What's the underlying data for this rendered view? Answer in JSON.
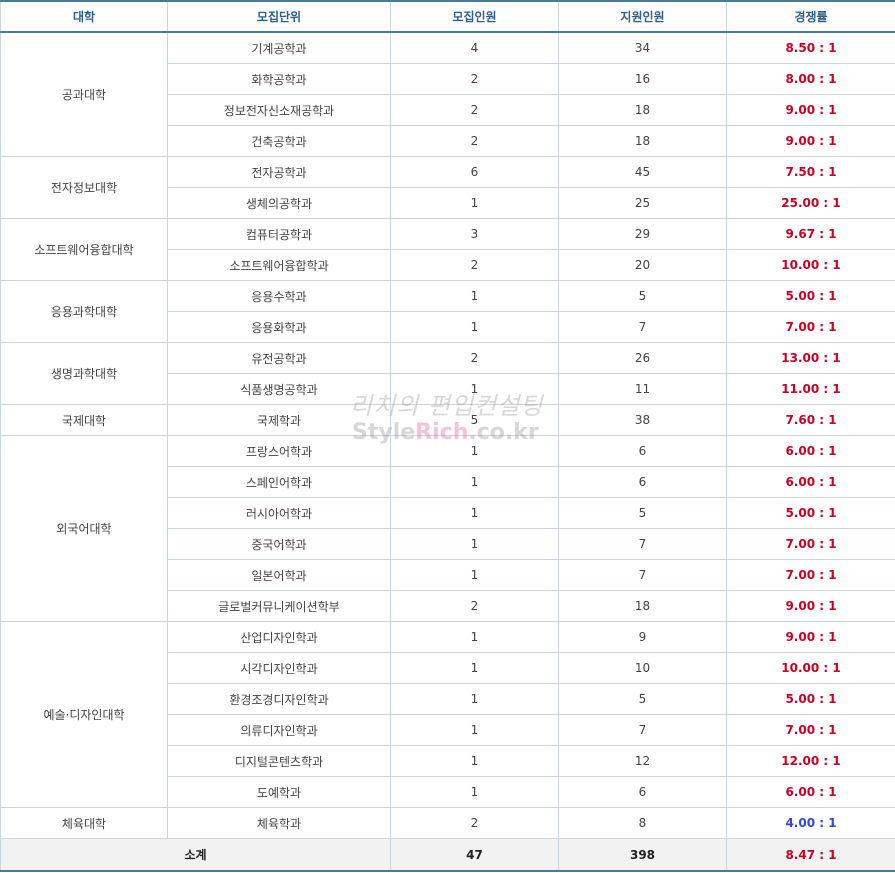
{
  "headers": {
    "college": "대학",
    "unit": "모집단위",
    "quota": "모집인원",
    "applicants": "지원인원",
    "ratio": "경쟁률"
  },
  "groups": [
    {
      "college": "공과대학",
      "rows": [
        {
          "unit": "기계공학과",
          "quota": "4",
          "applicants": "34",
          "ratio": "8.50 : 1"
        },
        {
          "unit": "화학공학과",
          "quota": "2",
          "applicants": "16",
          "ratio": "8.00 : 1"
        },
        {
          "unit": "정보전자신소재공학과",
          "quota": "2",
          "applicants": "18",
          "ratio": "9.00 : 1"
        },
        {
          "unit": "건축공학과",
          "quota": "2",
          "applicants": "18",
          "ratio": "9.00 : 1"
        }
      ]
    },
    {
      "college": "전자정보대학",
      "rows": [
        {
          "unit": "전자공학과",
          "quota": "6",
          "applicants": "45",
          "ratio": "7.50 : 1"
        },
        {
          "unit": "생체의공학과",
          "quota": "1",
          "applicants": "25",
          "ratio": "25.00 : 1"
        }
      ]
    },
    {
      "college": "소프트웨어융합대학",
      "rows": [
        {
          "unit": "컴퓨터공학과",
          "quota": "3",
          "applicants": "29",
          "ratio": "9.67 : 1"
        },
        {
          "unit": "소프트웨어융합학과",
          "quota": "2",
          "applicants": "20",
          "ratio": "10.00 : 1"
        }
      ]
    },
    {
      "college": "응용과학대학",
      "rows": [
        {
          "unit": "응용수학과",
          "quota": "1",
          "applicants": "5",
          "ratio": "5.00 : 1"
        },
        {
          "unit": "응용화학과",
          "quota": "1",
          "applicants": "7",
          "ratio": "7.00 : 1"
        }
      ]
    },
    {
      "college": "생명과학대학",
      "rows": [
        {
          "unit": "유전공학과",
          "quota": "2",
          "applicants": "26",
          "ratio": "13.00 : 1"
        },
        {
          "unit": "식품생명공학과",
          "quota": "1",
          "applicants": "11",
          "ratio": "11.00 : 1"
        }
      ]
    },
    {
      "college": "국제대학",
      "rows": [
        {
          "unit": "국제학과",
          "quota": "5",
          "applicants": "38",
          "ratio": "7.60 : 1"
        }
      ]
    },
    {
      "college": "외국어대학",
      "rows": [
        {
          "unit": "프랑스어학과",
          "quota": "1",
          "applicants": "6",
          "ratio": "6.00 : 1"
        },
        {
          "unit": "스페인어학과",
          "quota": "1",
          "applicants": "6",
          "ratio": "6.00 : 1"
        },
        {
          "unit": "러시아어학과",
          "quota": "1",
          "applicants": "5",
          "ratio": "5.00 : 1"
        },
        {
          "unit": "중국어학과",
          "quota": "1",
          "applicants": "7",
          "ratio": "7.00 : 1"
        },
        {
          "unit": "일본어학과",
          "quota": "1",
          "applicants": "7",
          "ratio": "7.00 : 1"
        },
        {
          "unit": "글로벌커뮤니케이션학부",
          "quota": "2",
          "applicants": "18",
          "ratio": "9.00 : 1"
        }
      ]
    },
    {
      "college": "예술·디자인대학",
      "rows": [
        {
          "unit": "산업디자인학과",
          "quota": "1",
          "applicants": "9",
          "ratio": "9.00 : 1"
        },
        {
          "unit": "시각디자인학과",
          "quota": "1",
          "applicants": "10",
          "ratio": "10.00 : 1"
        },
        {
          "unit": "환경조경디자인학과",
          "quota": "1",
          "applicants": "5",
          "ratio": "5.00 : 1"
        },
        {
          "unit": "의류디자인학과",
          "quota": "1",
          "applicants": "7",
          "ratio": "7.00 : 1"
        },
        {
          "unit": "디지털콘텐츠학과",
          "quota": "1",
          "applicants": "12",
          "ratio": "12.00 : 1"
        },
        {
          "unit": "도예학과",
          "quota": "1",
          "applicants": "6",
          "ratio": "6.00 : 1"
        }
      ]
    },
    {
      "college": "체육대학",
      "rows": [
        {
          "unit": "체육학과",
          "quota": "2",
          "applicants": "8",
          "ratio": "4.00 : 1",
          "highlight": "low"
        }
      ]
    }
  ],
  "total": {
    "label": "소계",
    "quota": "47",
    "applicants": "398",
    "ratio": "8.47 : 1"
  },
  "watermark": {
    "line1": "리치의 편입컨설팅",
    "line2_a": "Style",
    "line2_b": "Rich",
    "line2_c": ".co.kr"
  },
  "colors": {
    "header_text": "#2d5f8a",
    "ratio_red": "#cc0022",
    "ratio_blue": "#3344dd"
  }
}
